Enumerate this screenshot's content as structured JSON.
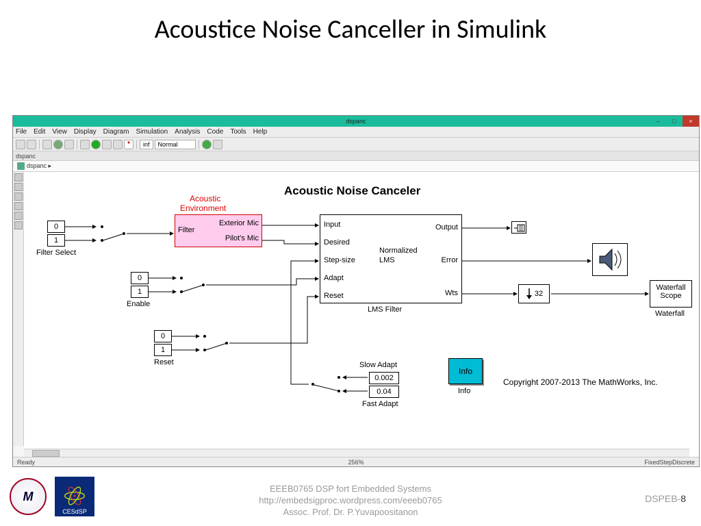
{
  "slide": {
    "title": "Acoustice Noise Canceller in Simulink"
  },
  "window": {
    "title": "dspanc",
    "min": "–",
    "max": "□",
    "close": "×",
    "menu": [
      "File",
      "Edit",
      "View",
      "Display",
      "Diagram",
      "Simulation",
      "Analysis",
      "Code",
      "Tools",
      "Help"
    ],
    "toolbar": {
      "stoptime": "inf",
      "mode": "Normal"
    },
    "tab": "dspanc",
    "breadcrumb": "dspanc ▸",
    "status": {
      "left": "Ready",
      "center": "256%",
      "right": "FixedStepDiscrete"
    }
  },
  "diagram": {
    "title": "Acoustic Noise Canceler",
    "acoustic_label_1": "Acoustic",
    "acoustic_label_2": "Environment",
    "filter_select": {
      "a": "0",
      "b": "1",
      "label": "Filter Select"
    },
    "enable": {
      "a": "0",
      "b": "1",
      "label": "Enable"
    },
    "reset": {
      "a": "0",
      "b": "1",
      "label": "Reset"
    },
    "filter_blk": {
      "name": "Filter",
      "out1": "Exterior Mic",
      "out2": "Pilot's Mic"
    },
    "lms": {
      "in": [
        "Input",
        "Desired",
        "Step-size",
        "Adapt",
        "Reset"
      ],
      "center1": "Normalized",
      "center2": "LMS",
      "out": [
        "Output",
        "Error",
        "Wts"
      ],
      "label": "LMS Filter"
    },
    "adapt": {
      "slow_lbl": "Slow Adapt",
      "fast_lbl": "Fast Adapt",
      "slow": "0.002",
      "fast": "0.04"
    },
    "down": "32",
    "info": {
      "text": "Info",
      "label": "Info"
    },
    "waterfall": {
      "line1": "Waterfall",
      "line2": "Scope",
      "label": "Waterfall"
    },
    "copyright": "Copyright 2007-2013 The MathWorks, Inc."
  },
  "footer": {
    "logo1": "M",
    "logo2": "CESdSP",
    "line1": "EEEB0765  DSP fort Embedded Systems",
    "line2": "http://embedsigproc.wordpress.com/eeeb0765",
    "line3": "Assoc. Prof. Dr. P.Yuvapoositanon",
    "right_prefix": "DSPEB-",
    "page": "8"
  }
}
